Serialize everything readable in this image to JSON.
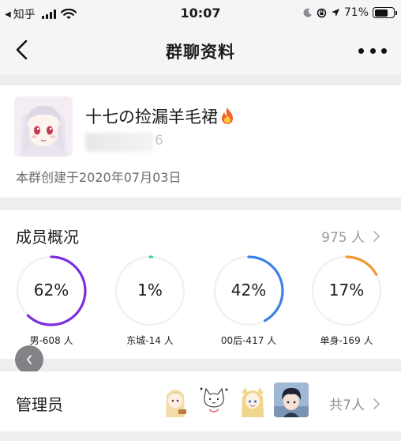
{
  "status_bar": {
    "app_back": "◀",
    "app_name": "知乎",
    "time": "10:07",
    "battery_percent": "71%",
    "battery_level": 0.71,
    "icons": [
      "signal-icon",
      "wifi-icon",
      "moon-icon",
      "rotation-lock-icon",
      "location-icon",
      "battery-icon"
    ]
  },
  "nav": {
    "title": "群聊资料",
    "back_icon": "chevron-left-icon",
    "more_icon": "more-dots-icon"
  },
  "group": {
    "name": "十七の捡漏羊毛裙",
    "name_emoji": "fire-icon",
    "id_visible_tail": "6",
    "created": "本群创建于2020年07月03日"
  },
  "members": {
    "title": "成员概况",
    "count": "975 人",
    "stats": [
      {
        "value": "62%",
        "fraction": 0.62,
        "label": "男-608 人",
        "color": "#7c2ee0"
      },
      {
        "value": "1%",
        "fraction": 0.01,
        "label": "东城-14 人",
        "color": "#3dd6a3"
      },
      {
        "value": "42%",
        "fraction": 0.42,
        "label": "00后-417 人",
        "color": "#3a82e8"
      },
      {
        "value": "17%",
        "fraction": 0.17,
        "label": "单身-169 人",
        "color": "#f0962f"
      }
    ]
  },
  "admins": {
    "title": "管理员",
    "count": "共7人"
  },
  "colors": {
    "background": "#eeeef0",
    "card": "#ffffff",
    "track": "#f1f1f3"
  }
}
